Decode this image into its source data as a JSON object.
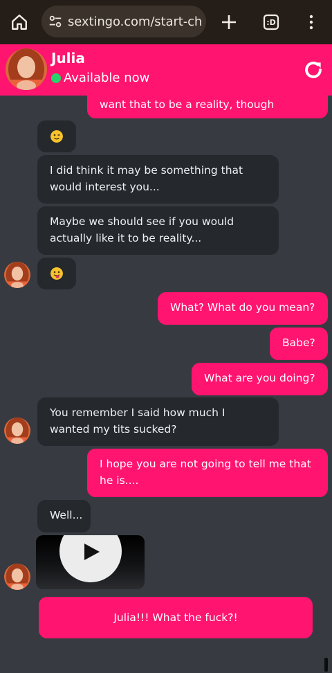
{
  "browser": {
    "url": "sextingo.com/start-ch",
    "tab_count": ":D"
  },
  "header": {
    "name": "Julia",
    "status": "Available now"
  },
  "messages": {
    "m1": "want that to be a reality, though",
    "m3": "I did think it may be something that would interest you...",
    "m4": "Maybe we should see if you would actually like it to be reality...",
    "m6": "What? What do you mean?",
    "m7": "Babe?",
    "m8": "What are you doing?",
    "m9": "You remember I said how much I wanted my tits sucked?",
    "m10": "I hope you are not going to tell me that he is....",
    "m11": "Well..."
  },
  "composer": {
    "text": "Julia!!! What the fuck?!"
  },
  "icons": {
    "home": "home-icon",
    "site_settings": "tune-icon",
    "new_tab": "plus-icon",
    "tabs": "tab-switcher-icon",
    "menu": "more-vert-icon",
    "refresh": "refresh-icon",
    "wink_emoji": "wink-emoji-icon",
    "tongue_emoji": "tongue-emoji-icon",
    "play": "play-icon"
  },
  "colors": {
    "accent": "#ff146f",
    "online": "#26d46b",
    "background": "#373b41",
    "incoming_bubble": "#25282d"
  }
}
